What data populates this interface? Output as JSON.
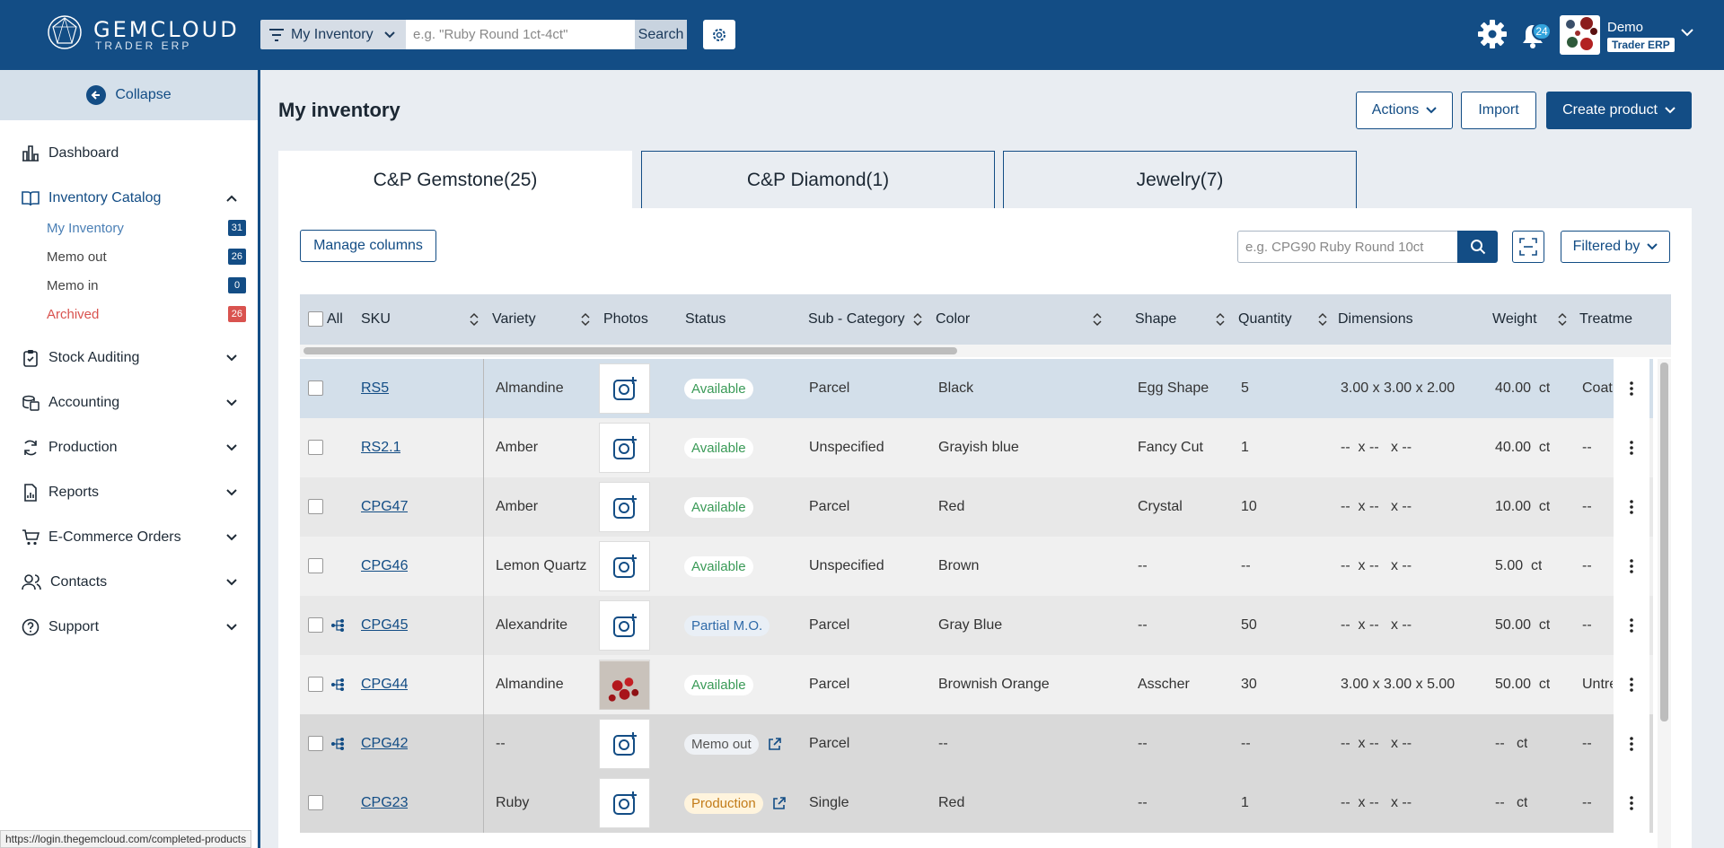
{
  "app": {
    "logo_name": "GEMCLOUD",
    "logo_sub": "TRADER ERP",
    "scope_label": "My Inventory",
    "search_placeholder": "e.g. \"Ruby Round 1ct-4ct\"",
    "search_button": "Search",
    "notification_count": "24",
    "user_name": "Demo",
    "user_role": "Trader ERP"
  },
  "sidebar": {
    "collapse_label": "Collapse",
    "items": [
      {
        "label": "Dashboard"
      },
      {
        "label": "Inventory Catalog"
      },
      {
        "label": "Stock Auditing"
      },
      {
        "label": "Accounting"
      },
      {
        "label": "Production"
      },
      {
        "label": "Reports"
      },
      {
        "label": "E-Commerce Orders"
      },
      {
        "label": "Contacts"
      },
      {
        "label": "Support"
      }
    ],
    "sub_items": [
      {
        "label": "My Inventory",
        "count": "31"
      },
      {
        "label": "Memo out",
        "count": "26"
      },
      {
        "label": "Memo in",
        "count": "0"
      },
      {
        "label": "Archived",
        "count": "26"
      }
    ],
    "status_url": "https://login.thegemcloud.com/completed-products"
  },
  "page": {
    "title": "My inventory",
    "actions_label": "Actions",
    "import_label": "Import",
    "create_label": "Create product"
  },
  "tabs": [
    {
      "label": "C&P Gemstone(25)"
    },
    {
      "label": "C&P Diamond(1)"
    },
    {
      "label": "Jewelry(7)"
    }
  ],
  "toolbar": {
    "manage_columns": "Manage columns",
    "search_placeholder": "e.g. CPG90 Ruby Round 10ct",
    "filter_label": "Filtered by"
  },
  "table": {
    "headers": {
      "all": "All",
      "sku": "SKU",
      "variety": "Variety",
      "photos": "Photos",
      "status": "Status",
      "subcategory": "Sub - Category",
      "color": "Color",
      "shape": "Shape",
      "quantity": "Quantity",
      "dimensions": "Dimensions",
      "weight": "Weight",
      "treatment": "Treatme"
    },
    "rows": [
      {
        "sku": "RS5",
        "variety": "Almandine",
        "status": "Available",
        "subcategory": "Parcel",
        "color": "Black",
        "shape": "Egg Shape",
        "quantity": "5",
        "dimensions": "3.00 x 3.00 x 2.00",
        "weight": "40.00  ct",
        "treatment": "Coati"
      },
      {
        "sku": "RS2.1",
        "variety": "Amber",
        "status": "Available",
        "subcategory": "Unspecified",
        "color": "Grayish blue",
        "shape": "Fancy Cut",
        "quantity": "1",
        "dimensions": "--  x --   x --",
        "weight": "40.00  ct",
        "treatment": "--"
      },
      {
        "sku": "CPG47",
        "variety": "Amber",
        "status": "Available",
        "subcategory": "Parcel",
        "color": "Red",
        "shape": "Crystal",
        "quantity": "10",
        "dimensions": "--  x --   x --",
        "weight": "10.00  ct",
        "treatment": "--"
      },
      {
        "sku": "CPG46",
        "variety": "Lemon Quartz",
        "status": "Available",
        "subcategory": "Unspecified",
        "color": "Brown",
        "shape": "--",
        "quantity": "--",
        "dimensions": "--  x --   x --",
        "weight": "5.00  ct",
        "treatment": "--"
      },
      {
        "sku": "CPG45",
        "variety": "Alexandrite",
        "status": "Partial M.O.",
        "subcategory": "Parcel",
        "color": "Gray Blue",
        "shape": "--",
        "quantity": "50",
        "dimensions": "--  x --   x --",
        "weight": "50.00  ct",
        "treatment": "--"
      },
      {
        "sku": "CPG44",
        "variety": "Almandine",
        "status": "Available",
        "subcategory": "Parcel",
        "color": "Brownish Orange",
        "shape": "Asscher",
        "quantity": "30",
        "dimensions": "3.00 x 3.00 x 5.00",
        "weight": "50.00  ct",
        "treatment": "Untre"
      },
      {
        "sku": "CPG42",
        "variety": "--",
        "status": "Memo out",
        "subcategory": "Parcel",
        "color": "--",
        "shape": "--",
        "quantity": "--",
        "dimensions": "--  x --   x --",
        "weight": "--   ct",
        "treatment": "--"
      },
      {
        "sku": "CPG23",
        "variety": "Ruby",
        "status": "Production",
        "subcategory": "Single",
        "color": "Red",
        "shape": "--",
        "quantity": "1",
        "dimensions": "--  x --   x --",
        "weight": "--   ct",
        "treatment": "--"
      }
    ]
  },
  "colors": {
    "brand": "#134d85",
    "available": "#3a9a57",
    "production": "#c27b18",
    "archived": "#d9534f"
  }
}
